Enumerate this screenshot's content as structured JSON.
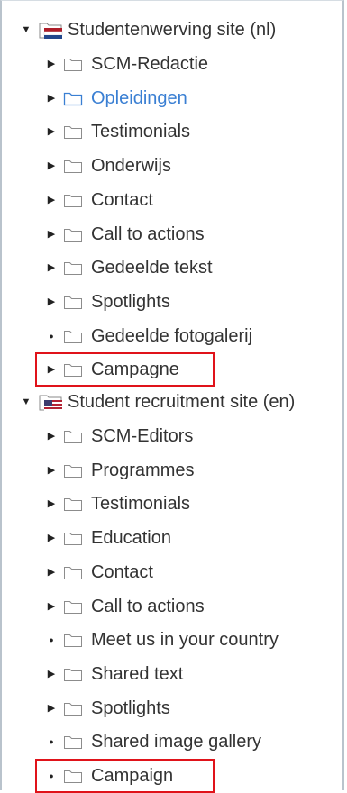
{
  "colors": {
    "text": "#333333",
    "selected_text": "#3a7fd3",
    "highlight_border": "#e0131a",
    "frame_border": "#b9c3cc"
  },
  "tree": {
    "site_nl": {
      "label": "Studentenwerving site (nl)",
      "icon": "flag-nl-folder-icon",
      "children": [
        {
          "label": "SCM-Redactie",
          "toggle": "collapsed"
        },
        {
          "label": "Opleidingen",
          "toggle": "collapsed",
          "selected": true
        },
        {
          "label": "Testimonials",
          "toggle": "collapsed"
        },
        {
          "label": "Onderwijs",
          "toggle": "collapsed"
        },
        {
          "label": "Contact",
          "toggle": "collapsed"
        },
        {
          "label": "Call to actions",
          "toggle": "collapsed"
        },
        {
          "label": "Gedeelde tekst",
          "toggle": "collapsed"
        },
        {
          "label": "Spotlights",
          "toggle": "collapsed"
        },
        {
          "label": "Gedeelde fotogalerij",
          "toggle": "leaf"
        },
        {
          "label": "Campagne",
          "toggle": "collapsed",
          "highlighted": true
        }
      ]
    },
    "site_en": {
      "label": "Student recruitment site (en)",
      "icon": "flag-us-folder-icon",
      "children": [
        {
          "label": "SCM-Editors",
          "toggle": "collapsed"
        },
        {
          "label": "Programmes",
          "toggle": "collapsed"
        },
        {
          "label": "Testimonials",
          "toggle": "collapsed"
        },
        {
          "label": "Education",
          "toggle": "collapsed"
        },
        {
          "label": "Contact",
          "toggle": "collapsed"
        },
        {
          "label": "Call to actions",
          "toggle": "collapsed"
        },
        {
          "label": "Meet us in your country",
          "toggle": "leaf"
        },
        {
          "label": "Shared text",
          "toggle": "collapsed"
        },
        {
          "label": "Spotlights",
          "toggle": "collapsed"
        },
        {
          "label": "Shared image gallery",
          "toggle": "leaf"
        },
        {
          "label": "Campaign",
          "toggle": "leaf",
          "highlighted": true
        }
      ]
    }
  }
}
